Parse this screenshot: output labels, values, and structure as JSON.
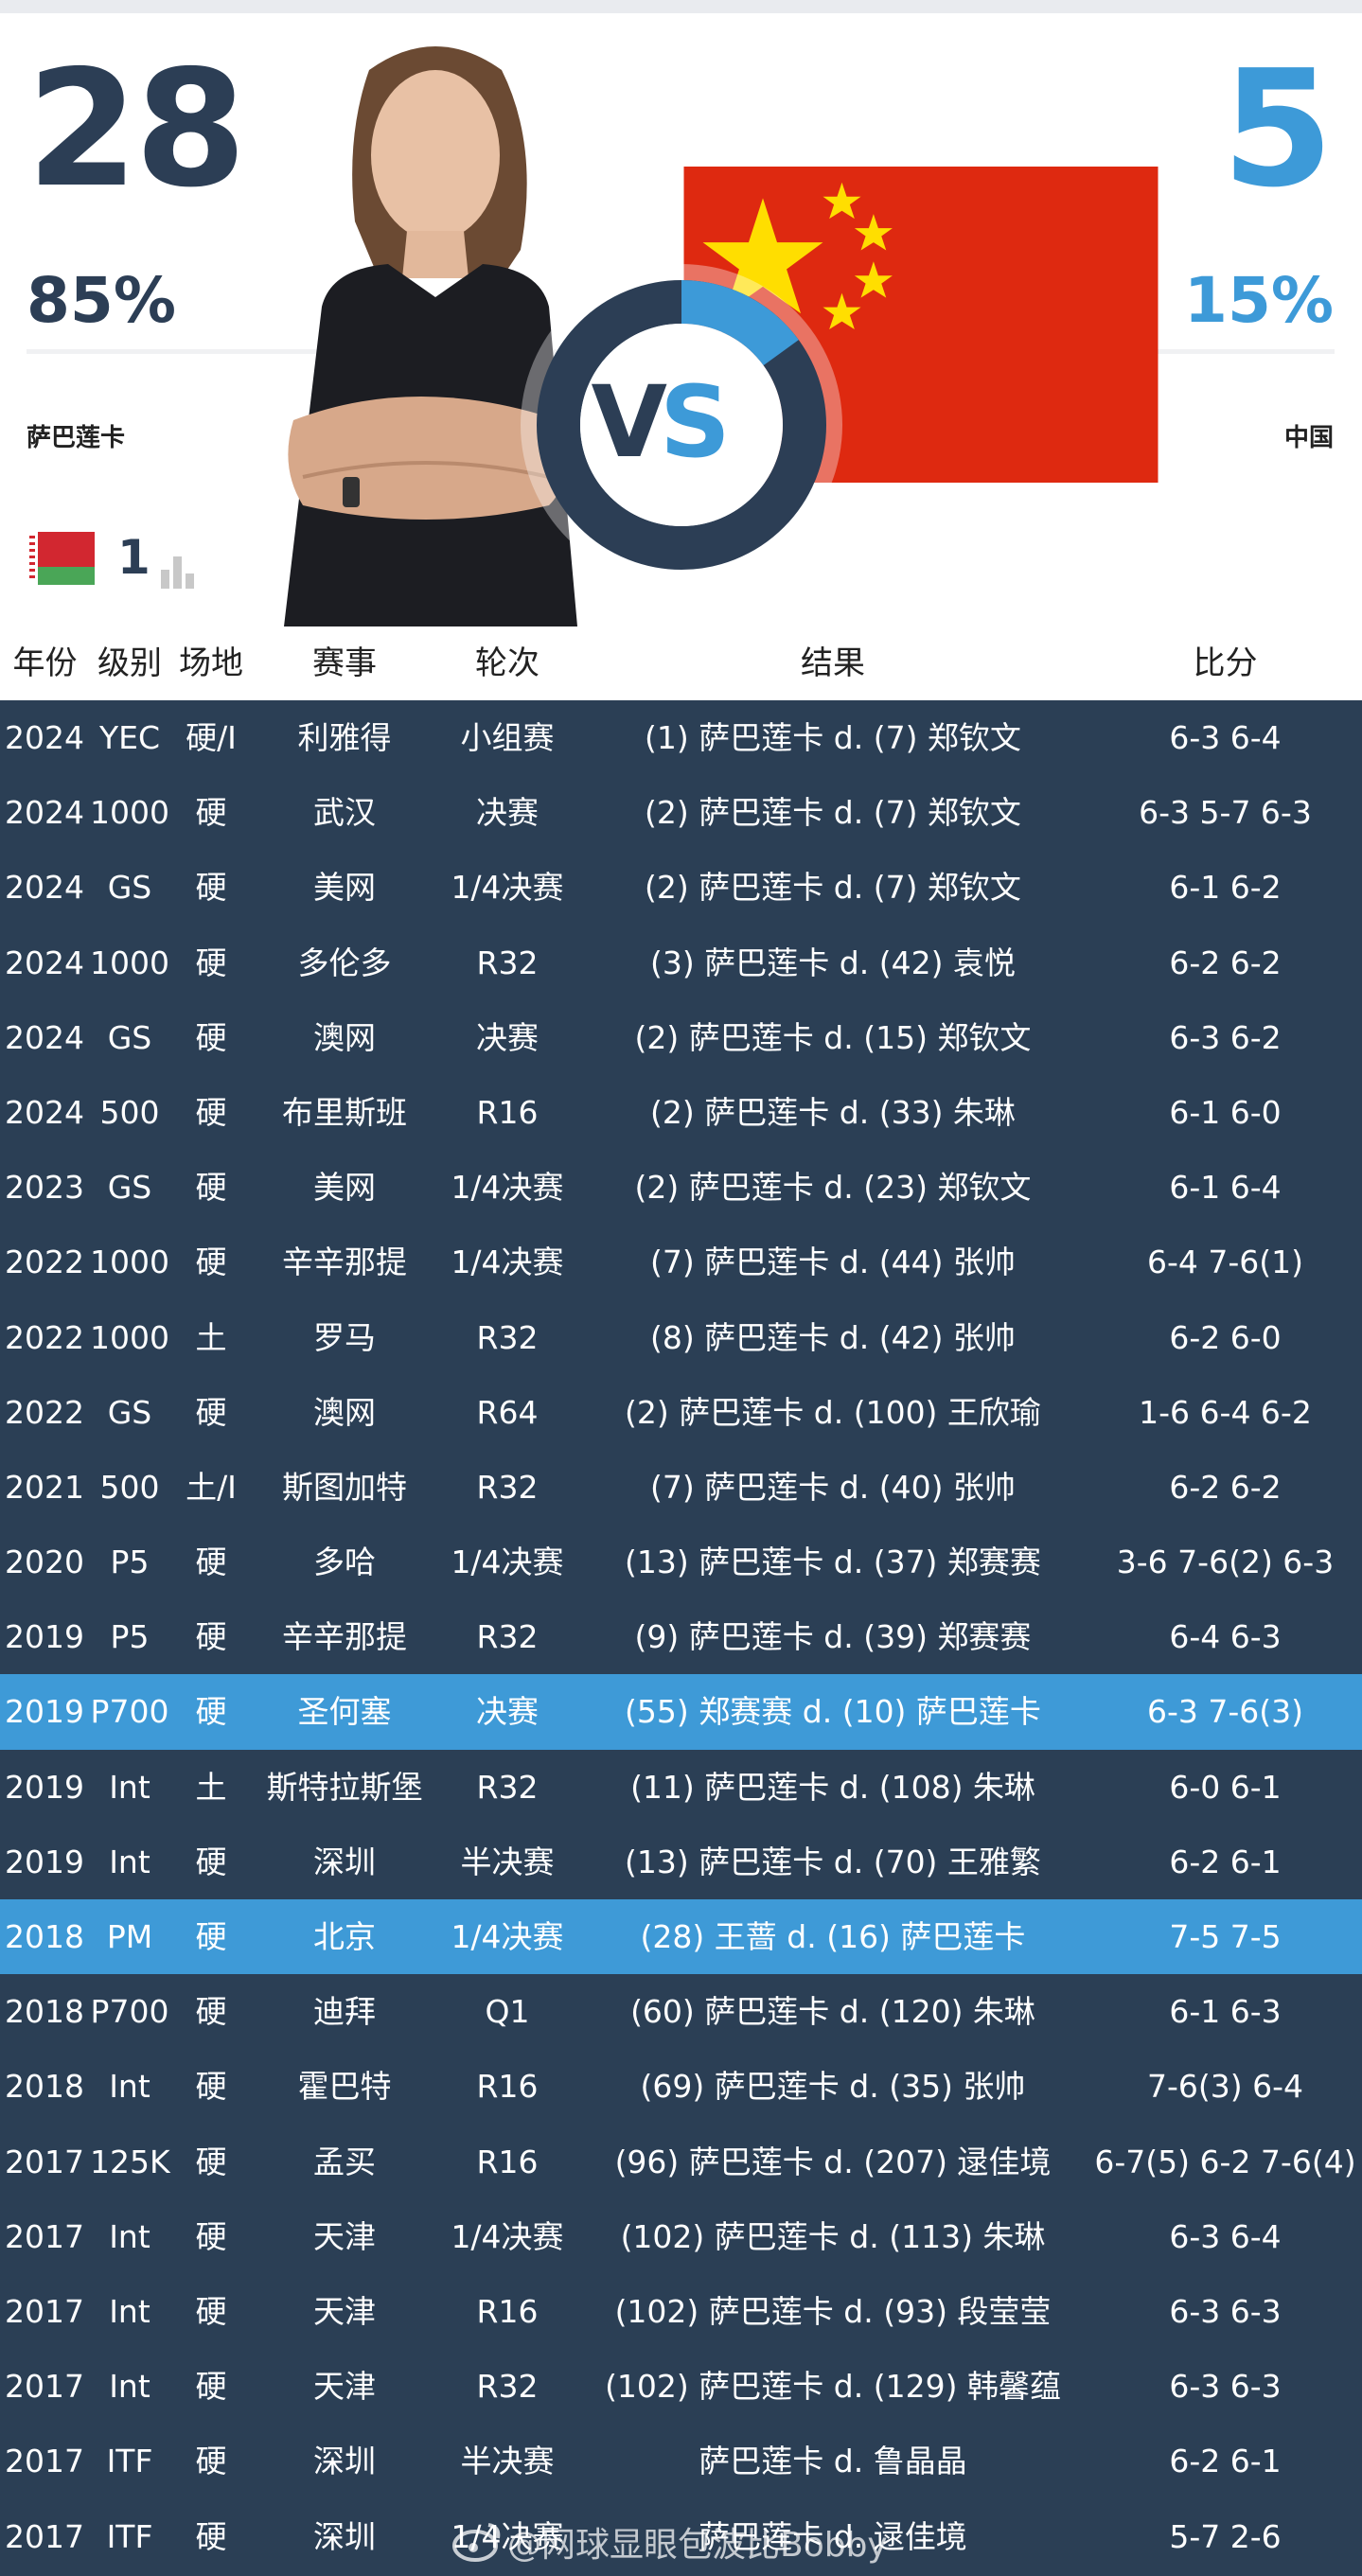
{
  "header": {
    "left_wins": "28",
    "right_wins": "5",
    "left_pct": "85%",
    "right_pct": "15%",
    "left_name": "萨巴莲卡",
    "right_name": "中国",
    "left_rank": "1",
    "vs_text_v": "V",
    "vs_text_s": "S",
    "left_share": 0.85,
    "colors": {
      "left": "#2c3e55",
      "right": "#3d9ad8"
    }
  },
  "table": {
    "columns": [
      "年份",
      "级别",
      "场地",
      "赛事",
      "轮次",
      "结果",
      "比分"
    ],
    "rows": [
      {
        "year": "2024",
        "level": "YEC",
        "surface": "硬/I",
        "event": "利雅得",
        "round": "小组赛",
        "result": "(1) 萨巴莲卡 d. (7) 郑钦文",
        "score": "6-3 6-4",
        "highlight": false
      },
      {
        "year": "2024",
        "level": "1000",
        "surface": "硬",
        "event": "武汉",
        "round": "决赛",
        "result": "(2) 萨巴莲卡 d. (7) 郑钦文",
        "score": "6-3 5-7 6-3",
        "highlight": false
      },
      {
        "year": "2024",
        "level": "GS",
        "surface": "硬",
        "event": "美网",
        "round": "1/4决赛",
        "result": "(2) 萨巴莲卡 d. (7) 郑钦文",
        "score": "6-1 6-2",
        "highlight": false
      },
      {
        "year": "2024",
        "level": "1000",
        "surface": "硬",
        "event": "多伦多",
        "round": "R32",
        "result": "(3) 萨巴莲卡 d. (42) 袁悦",
        "score": "6-2 6-2",
        "highlight": false
      },
      {
        "year": "2024",
        "level": "GS",
        "surface": "硬",
        "event": "澳网",
        "round": "决赛",
        "result": "(2) 萨巴莲卡 d. (15) 郑钦文",
        "score": "6-3 6-2",
        "highlight": false
      },
      {
        "year": "2024",
        "level": "500",
        "surface": "硬",
        "event": "布里斯班",
        "round": "R16",
        "result": "(2) 萨巴莲卡 d. (33) 朱琳",
        "score": "6-1 6-0",
        "highlight": false
      },
      {
        "year": "2023",
        "level": "GS",
        "surface": "硬",
        "event": "美网",
        "round": "1/4决赛",
        "result": "(2) 萨巴莲卡 d. (23) 郑钦文",
        "score": "6-1 6-4",
        "highlight": false
      },
      {
        "year": "2022",
        "level": "1000",
        "surface": "硬",
        "event": "辛辛那提",
        "round": "1/4决赛",
        "result": "(7) 萨巴莲卡 d. (44) 张帅",
        "score": "6-4 7-6(1)",
        "highlight": false
      },
      {
        "year": "2022",
        "level": "1000",
        "surface": "土",
        "event": "罗马",
        "round": "R32",
        "result": "(8) 萨巴莲卡 d. (42) 张帅",
        "score": "6-2 6-0",
        "highlight": false
      },
      {
        "year": "2022",
        "level": "GS",
        "surface": "硬",
        "event": "澳网",
        "round": "R64",
        "result": "(2) 萨巴莲卡 d. (100) 王欣瑜",
        "score": "1-6 6-4 6-2",
        "highlight": false
      },
      {
        "year": "2021",
        "level": "500",
        "surface": "土/I",
        "event": "斯图加特",
        "round": "R32",
        "result": "(7) 萨巴莲卡 d. (40) 张帅",
        "score": "6-2 6-2",
        "highlight": false
      },
      {
        "year": "2020",
        "level": "P5",
        "surface": "硬",
        "event": "多哈",
        "round": "1/4决赛",
        "result": "(13) 萨巴莲卡 d. (37) 郑赛赛",
        "score": "3-6 7-6(2) 6-3",
        "highlight": false
      },
      {
        "year": "2019",
        "level": "P5",
        "surface": "硬",
        "event": "辛辛那提",
        "round": "R32",
        "result": "(9) 萨巴莲卡 d. (39) 郑赛赛",
        "score": "6-4 6-3",
        "highlight": false
      },
      {
        "year": "2019",
        "level": "P700",
        "surface": "硬",
        "event": "圣何塞",
        "round": "决赛",
        "result": "(55) 郑赛赛 d. (10) 萨巴莲卡",
        "score": "6-3 7-6(3)",
        "highlight": true
      },
      {
        "year": "2019",
        "level": "Int",
        "surface": "土",
        "event": "斯特拉斯堡",
        "round": "R32",
        "result": "(11) 萨巴莲卡 d. (108) 朱琳",
        "score": "6-0 6-1",
        "highlight": false
      },
      {
        "year": "2019",
        "level": "Int",
        "surface": "硬",
        "event": "深圳",
        "round": "半决赛",
        "result": "(13) 萨巴莲卡 d. (70) 王雅繁",
        "score": "6-2 6-1",
        "highlight": false
      },
      {
        "year": "2018",
        "level": "PM",
        "surface": "硬",
        "event": "北京",
        "round": "1/4决赛",
        "result": "(28) 王蔷 d. (16) 萨巴莲卡",
        "score": "7-5 7-5",
        "highlight": true
      },
      {
        "year": "2018",
        "level": "P700",
        "surface": "硬",
        "event": "迪拜",
        "round": "Q1",
        "result": "(60) 萨巴莲卡 d. (120) 朱琳",
        "score": "6-1 6-3",
        "highlight": false
      },
      {
        "year": "2018",
        "level": "Int",
        "surface": "硬",
        "event": "霍巴特",
        "round": "R16",
        "result": "(69) 萨巴莲卡 d. (35) 张帅",
        "score": "7-6(3) 6-4",
        "highlight": false
      },
      {
        "year": "2017",
        "level": "125K",
        "surface": "硬",
        "event": "孟买",
        "round": "R16",
        "result": "(96) 萨巴莲卡 d. (207) 逯佳境",
        "score": "6-7(5) 6-2 7-6(4)",
        "highlight": false
      },
      {
        "year": "2017",
        "level": "Int",
        "surface": "硬",
        "event": "天津",
        "round": "1/4决赛",
        "result": "(102) 萨巴莲卡 d. (113) 朱琳",
        "score": "6-3 6-4",
        "highlight": false
      },
      {
        "year": "2017",
        "level": "Int",
        "surface": "硬",
        "event": "天津",
        "round": "R16",
        "result": "(102) 萨巴莲卡 d. (93) 段莹莹",
        "score": "6-3 6-3",
        "highlight": false
      },
      {
        "year": "2017",
        "level": "Int",
        "surface": "硬",
        "event": "天津",
        "round": "R32",
        "result": "(102) 萨巴莲卡 d. (129) 韩馨蕴",
        "score": "6-3 6-3",
        "highlight": false
      },
      {
        "year": "2017",
        "level": "ITF",
        "surface": "硬",
        "event": "深圳",
        "round": "半决赛",
        "result": "萨巴莲卡 d. 鲁晶晶",
        "score": "6-2 6-1",
        "highlight": false
      },
      {
        "year": "2017",
        "level": "ITF",
        "surface": "硬",
        "event": "深圳",
        "round": "1/4决赛",
        "result": "萨巴莲卡 d. 逯佳境",
        "score": "5-7 2-6",
        "highlight": false
      }
    ]
  },
  "watermark": "@网球显眼包波比Bobby"
}
